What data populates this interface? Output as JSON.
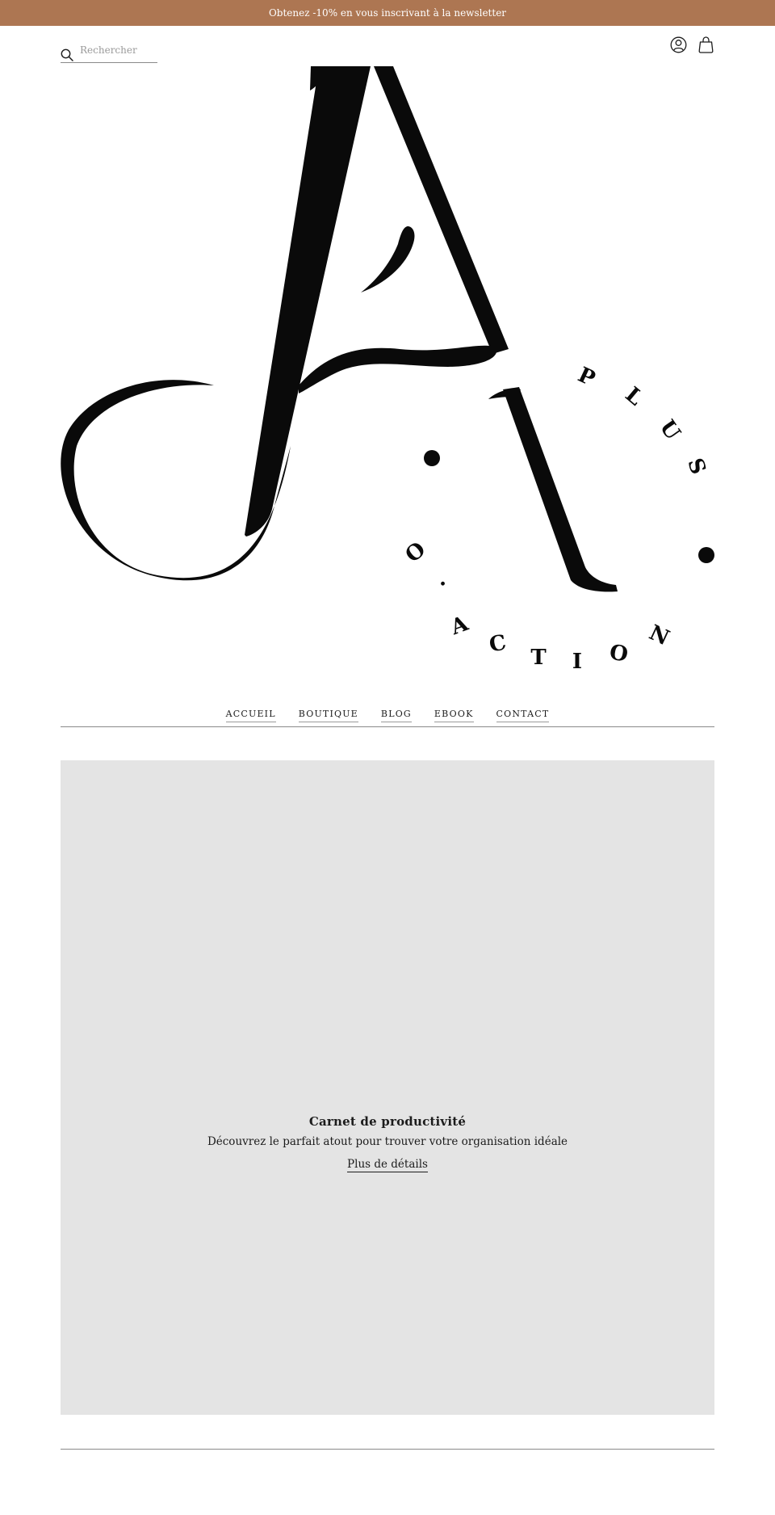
{
  "colors": {
    "announcement_bg": "#ad7652",
    "hero_bg": "#e4e4e4",
    "text": "#1c1c1c",
    "divider": "#8a8a8a"
  },
  "announcement": {
    "text": "Obtenez -10% en vous inscrivant à la newsletter"
  },
  "header": {
    "search": {
      "placeholder": "Rechercher",
      "icon": "search-icon"
    },
    "icons": [
      "account-icon",
      "cart-icon"
    ]
  },
  "logo": {
    "monogram": "JA",
    "ring_text": "PLUS ACTION"
  },
  "nav": {
    "items": [
      {
        "label": "ACCUEIL"
      },
      {
        "label": "BOUTIQUE"
      },
      {
        "label": "BLOG"
      },
      {
        "label": "EBOOK"
      },
      {
        "label": "CONTACT"
      }
    ]
  },
  "hero": {
    "title": "Carnet de productivité",
    "subtitle": "Découvrez le parfait atout pour trouver votre organisation idéale",
    "link_label": "Plus de détails"
  }
}
